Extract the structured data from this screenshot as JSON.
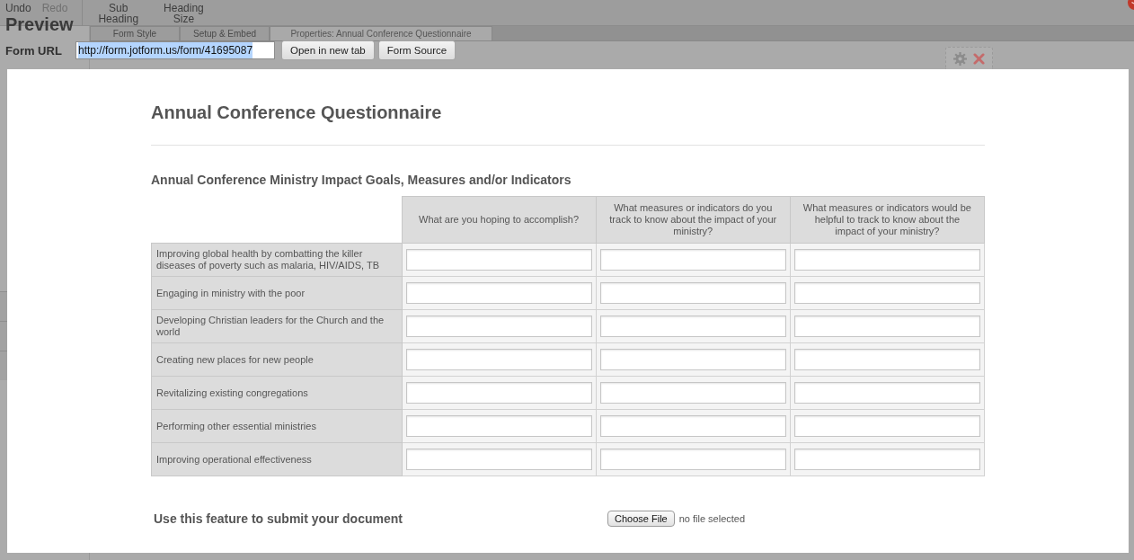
{
  "toolbar": {
    "items": [
      {
        "label": "Undo",
        "disabled": false
      },
      {
        "label": "Redo",
        "disabled": true
      },
      {
        "label": "Sub Heading",
        "disabled": false
      },
      {
        "label": "Heading Size",
        "disabled": false
      }
    ]
  },
  "tabs": [
    {
      "label": "Form Style",
      "selected": false
    },
    {
      "label": "Setup & Embed",
      "selected": false
    },
    {
      "label": "Properties: Annual Conference Questionnaire",
      "selected": true
    }
  ],
  "preview": {
    "title": "Preview",
    "url_label": "Form URL",
    "url": "http://form.jotform.us/form/41695087",
    "url_highlighted": true,
    "buttons": [
      "Open in new tab",
      "Form Source"
    ]
  },
  "form": {
    "title": "Annual Conference Questionnaire",
    "matrix": {
      "title": "Annual Conference Ministry Impact Goals, Measures and/or Indicators",
      "columns": [
        "What are you hoping to accomplish?",
        "What measures or indicators do you track to know about the impact of your ministry?",
        "What measures or indicators would be helpful to track to know about the impact of your ministry?"
      ],
      "rows": [
        "Improving global health by combatting the killer diseases of poverty such as malaria, HIV/AIDS, TB",
        "Engaging in ministry with the poor",
        "Developing Christian leaders for the Church and the world",
        "Creating new places for new people",
        "Revitalizing existing congregations",
        "Performing other essential ministries",
        "Improving operational effectiveness"
      ]
    },
    "upload": {
      "label": "Use this feature to submit your document",
      "button": "Choose File",
      "status": "no file selected"
    }
  }
}
